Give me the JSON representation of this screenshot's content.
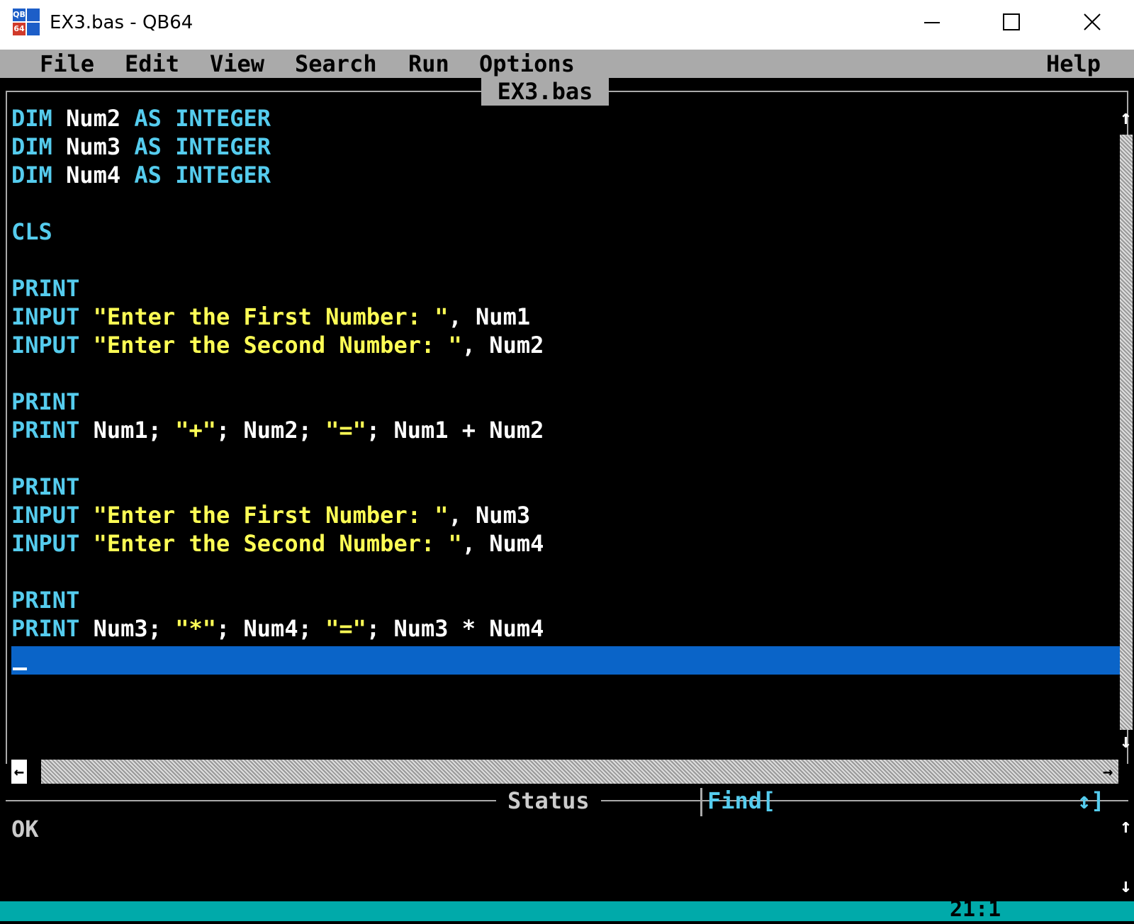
{
  "window": {
    "title": "EX3.bas - QB64",
    "icon_text": [
      "QB",
      "64"
    ],
    "controls": [
      "minimize-icon",
      "maximize-icon",
      "close-icon"
    ]
  },
  "menu": {
    "items": [
      "File",
      "Edit",
      "View",
      "Search",
      "Run",
      "Options"
    ],
    "help": "Help"
  },
  "editor": {
    "tab": "EX3.bas",
    "lines": [
      [
        [
          "kw",
          "DIM "
        ],
        [
          "id",
          "Num2 "
        ],
        [
          "kw",
          "AS INTEGER"
        ]
      ],
      [
        [
          "kw",
          "DIM "
        ],
        [
          "id",
          "Num3 "
        ],
        [
          "kw",
          "AS INTEGER"
        ]
      ],
      [
        [
          "kw",
          "DIM "
        ],
        [
          "id",
          "Num4 "
        ],
        [
          "kw",
          "AS INTEGER"
        ]
      ],
      [],
      [
        [
          "kw",
          "CLS"
        ]
      ],
      [],
      [
        [
          "kw",
          "PRINT"
        ]
      ],
      [
        [
          "kw",
          "INPUT "
        ],
        [
          "str",
          "\"Enter the First Number: \""
        ],
        [
          "id",
          ", Num1"
        ]
      ],
      [
        [
          "kw",
          "INPUT "
        ],
        [
          "str",
          "\"Enter the Second Number: \""
        ],
        [
          "id",
          ", Num2"
        ]
      ],
      [],
      [
        [
          "kw",
          "PRINT"
        ]
      ],
      [
        [
          "kw",
          "PRINT "
        ],
        [
          "id",
          "Num1; "
        ],
        [
          "str",
          "\"+\""
        ],
        [
          "id",
          "; Num2; "
        ],
        [
          "str",
          "\"=\""
        ],
        [
          "id",
          "; Num1 + Num2"
        ]
      ],
      [],
      [
        [
          "kw",
          "PRINT"
        ]
      ],
      [
        [
          "kw",
          "INPUT "
        ],
        [
          "str",
          "\"Enter the First Number: \""
        ],
        [
          "id",
          ", Num3"
        ]
      ],
      [
        [
          "kw",
          "INPUT "
        ],
        [
          "str",
          "\"Enter the Second Number: \""
        ],
        [
          "id",
          ", Num4"
        ]
      ],
      [],
      [
        [
          "kw",
          "PRINT"
        ]
      ],
      [
        [
          "kw",
          "PRINT "
        ],
        [
          "id",
          "Num3; "
        ],
        [
          "str",
          "\"*\""
        ],
        [
          "id",
          "; Num4; "
        ],
        [
          "str",
          "\"=\""
        ],
        [
          "id",
          "; Num3 * Num4"
        ]
      ]
    ]
  },
  "status": {
    "title": "Status",
    "find_label": "Find[",
    "find_end": "↕]",
    "message": "OK"
  },
  "bottom": {
    "cursor_position": "21:1"
  },
  "colors": {
    "keyword": "#55ccee",
    "string": "#ffff55",
    "identifier": "#ffffff",
    "current_line": "#0a64c8",
    "menubar": "#aaaaaa",
    "bottom_strip": "#00aaaa"
  }
}
